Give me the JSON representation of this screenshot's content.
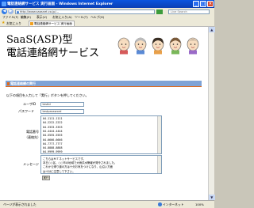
{
  "window": {
    "title": "電話連絡網サービス 実行画面 - Windows Internet Explorer",
    "min": "_",
    "max": "□",
    "close": "×"
  },
  "address_bar": {
    "url": "http://www.saasnet.co.jp/...",
    "search_placeholder": "Live Search",
    "back": "◀",
    "forward": "▶"
  },
  "menu": [
    "ファイル(F)",
    "編集(E)",
    "表示(V)",
    "お気に入り(A)",
    "ツール(T)",
    "ヘルプ(H)"
  ],
  "favorites_bar": {
    "favorites_label": "お気に入り",
    "tab_label": "電話連絡網サービス 実行画面"
  },
  "page": {
    "title_line1": "SaaS(ASP)型",
    "title_line2": "電話連絡網サービス",
    "section_title": "電話連絡網の実行",
    "instruction": "以下の項目を入力して「実行」ボタンを押してください。",
    "user_id_label": "ユーザID",
    "user_id_value": "testid",
    "password_label": "パスワード",
    "password_value": "testpassword",
    "phone_label_line1": "電話番号",
    "phone_label_line2": "（連絡先）",
    "phone_numbers": [
      "04-1111-1111",
      "04-2222-2222",
      "04-3333-3333",
      "04-4444-4444",
      "04-5555-5555",
      "04-6666-6666",
      "04-7777-7777",
      "04-8888-8888",
      "04-9999-9999"
    ],
    "message_label": "メッセージ",
    "message_lines": [
      "こちらはＭＴネットサービスです。",
      "本日○○区、○○市の地域で大雨洪水警報が発令されました。",
      "これから帰り道の方は十分お気をつけになり、山沿い方面",
      "は十分に注意して下さい。"
    ],
    "execute_button": "実行"
  },
  "status_bar": {
    "left_text": "ページが表示されました",
    "zone": "インターネット",
    "zoom": "100%"
  }
}
